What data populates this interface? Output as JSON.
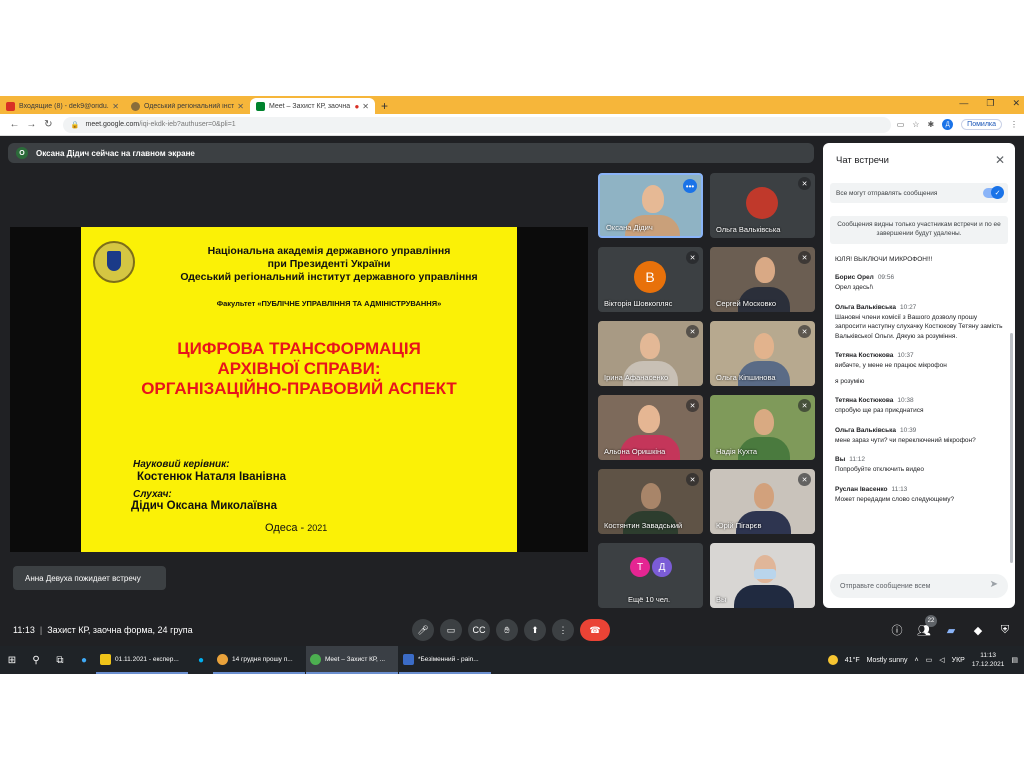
{
  "browser": {
    "tabs": [
      {
        "label": "Входящие (8) - dek9@oridu.odes",
        "color": "#d93025"
      },
      {
        "label": "Одеський регіональний інститут",
        "color": "#8a6d3b"
      },
      {
        "label": "Meet – Захист КР, заочна ф",
        "color": "#00832d"
      }
    ],
    "new_tab": "+",
    "url_host": "meet.google.com",
    "url_path": "/iqi-ekdk-ieb?authuser=0&pli=1",
    "profile_initial": "Д",
    "error_label": "Помилка"
  },
  "meet": {
    "presenting_badge": "О",
    "presenting_text": "Оксана Дідич сейчас на главном экране",
    "toast": "Анна Девуха пожидает встречу",
    "time": "11:13",
    "meeting_name": "Захист КР, заочна форма, 24 група",
    "people_count": "22"
  },
  "slide": {
    "academy": "Національна академія державного управління",
    "president": "при Президенті України",
    "institute": "Одеський регіональний інститут державного управління",
    "faculty": "Факультет «ПУБЛІЧНЕ УПРАВЛІННЯ ТА АДМІНІСТРУВАННЯ»",
    "title_1": "ЦИФРОВА ТРАНСФОРМАЦІЯ",
    "title_2": "АРХІВНОЇ СПРАВИ:",
    "title_3": "ОРГАНІЗАЦІЙНО-ПРАВОВИЙ АСПЕКТ",
    "supervisor_label": "Науковий керівник:",
    "supervisor_name": "Костенюк Наталя Іванівна",
    "listener_label": "Слухач:",
    "listener_name": "Дідич Оксана Миколаївна",
    "city": "Одеса - ",
    "year": "2021"
  },
  "participants": [
    {
      "name": "Оксана Дідич"
    },
    {
      "name": "Ольга Вальківська"
    },
    {
      "name": "Вікторія Шовкопляс",
      "initial": "В",
      "color": "#e8710a"
    },
    {
      "name": "Сергей Московко"
    },
    {
      "name": "Ірина Афанасенко"
    },
    {
      "name": "Ольга Кіпшинова"
    },
    {
      "name": "Альона Оришкіна"
    },
    {
      "name": "Надія Кухта"
    },
    {
      "name": "Костянтин Завадський"
    },
    {
      "name": "Юрій Пігарєв"
    },
    {
      "name": "Ещё 10 чел.",
      "initial_1": "Т",
      "color_1": "#e52592",
      "initial_2": "Д",
      "color_2": "#7b5cd6"
    },
    {
      "name": "Вы"
    }
  ],
  "chat": {
    "title": "Чат встречи",
    "toggle_label": "Все могут отправлять сообщения",
    "notice": "Сообщения видны только участникам встречи и по ее завершении будут удалены.",
    "partial_top": "ЮЛЯ! ВЫКЛЮЧИ МИКРОФОН!!!",
    "messages": [
      {
        "author": "Борис Орел",
        "time": "09:56",
        "text": "Орел здесь!\\"
      },
      {
        "author": "Ольга Вальківська",
        "time": "10:27",
        "text": "Шановні члени комісії з Вашого дозволу прошу запросити наступну слухачку Костюкову Тетяну замість Вальківської Ольги. Дякую за розуміння."
      },
      {
        "author": "Тетяна Костюкова",
        "time": "10:37",
        "text": "вибачте, у мене не працює мікрофон",
        "text2": "я розумію"
      },
      {
        "author": "Тетяна Костюкова",
        "time": "10:38",
        "text": "спробую ще раз приєднатися"
      },
      {
        "author": "Ольга Вальківська",
        "time": "10:39",
        "text": "мене зараз чути? чи переключений мікрофон?"
      },
      {
        "author": "Вы",
        "time": "11:12",
        "text": "Попробуйте отключить видео"
      },
      {
        "author": "Руслан Івасенко",
        "time": "11:13",
        "text": "Может передадим слово следующему?"
      }
    ],
    "input_placeholder": "Отправьте сообщение всем"
  },
  "taskbar": {
    "apps": [
      {
        "label": "01.11.2021 - експер...",
        "color": "#f0c419"
      },
      {
        "label": "14 грудня прошу п...",
        "color": "#e9a23b"
      },
      {
        "label": "Meet – Захист КР, ...",
        "color": "#4caf50"
      },
      {
        "label": "*Безіменний - pain...",
        "color": "#3b6cc7"
      }
    ],
    "weather_temp": "41°F",
    "weather_text": "Mostly sunny",
    "lang": "УКР",
    "clock_time": "11:13",
    "clock_date": "17.12.2021"
  }
}
